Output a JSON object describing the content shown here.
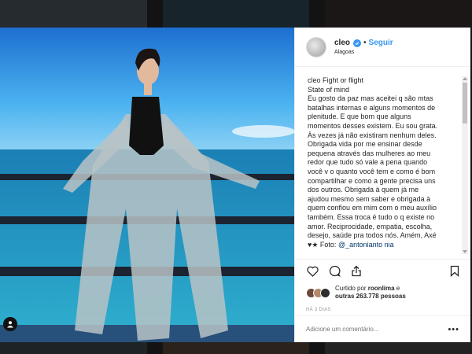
{
  "post": {
    "username": "cleo",
    "verified": true,
    "follow_label": "Seguir",
    "location": "Alagoas",
    "caption_user": "cleo",
    "caption_lines": [
      "Fight or flight",
      "State of mind",
      "Eu gosto da paz mas aceitei q são mtas",
      "batalhas internas e alguns momentos de",
      "plenitude. E que bom que alguns",
      "momentos desses existem. Eu sou grata.",
      "Às vezes já não existiram nenhum deles.",
      "Obrigada vida por me ensinar desde",
      "pequena através das mulheres ao meu",
      "redor que tudo só vale a pena quando",
      "você v o quanto você tem e como é bom",
      "compartilhar e como a gente precisa uns",
      "dos outros. Obrigada à quem já me",
      "ajudou mesmo sem saber e obrigada à",
      "quem confiou em mim com o meu auxílio",
      "também. Essa troca é tudo o q existe no",
      "amor. Reciprocidade, empatia, escolha,",
      "desejo, saúde pra todos nós. Amém, Axé"
    ],
    "photo_credit_prefix": "♥★ Foto: ",
    "photo_credit_mention": "@_antonianto nia",
    "liked_by_prefix": "Curtido por ",
    "liked_by_user": "roonlima",
    "liked_by_suffix": " e",
    "others_count_text": "outras 263.778 pessoas",
    "timestamp": "HÁ 3 DIAS",
    "comment_placeholder": "Adicione um comentário...",
    "more_label": "•••"
  },
  "icons": {
    "like": "heart-icon",
    "comment": "comment-icon",
    "share": "share-icon",
    "save": "bookmark-icon",
    "user_tag": "user-icon",
    "verified": "verified-badge-icon"
  },
  "colors": {
    "accent": "#3897f0",
    "text": "#262626",
    "muted": "#999999",
    "sky": "#3ea6e6",
    "sea": "#1a8fb8"
  }
}
